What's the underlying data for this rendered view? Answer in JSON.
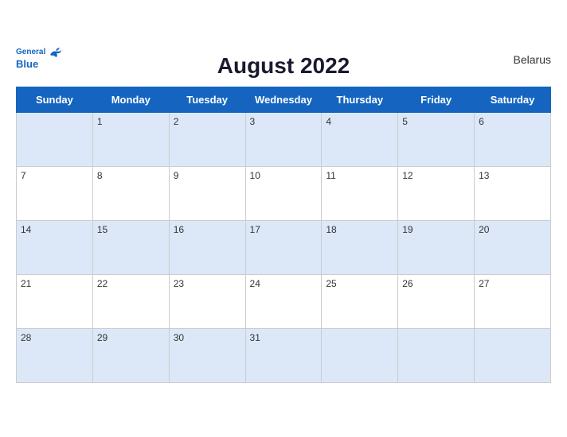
{
  "header": {
    "title": "August 2022",
    "country": "Belarus",
    "logo_general": "General",
    "logo_blue": "Blue"
  },
  "weekdays": [
    "Sunday",
    "Monday",
    "Tuesday",
    "Wednesday",
    "Thursday",
    "Friday",
    "Saturday"
  ],
  "weeks": [
    [
      "",
      "1",
      "2",
      "3",
      "4",
      "5",
      "6"
    ],
    [
      "7",
      "8",
      "9",
      "10",
      "11",
      "12",
      "13"
    ],
    [
      "14",
      "15",
      "16",
      "17",
      "18",
      "19",
      "20"
    ],
    [
      "21",
      "22",
      "23",
      "24",
      "25",
      "26",
      "27"
    ],
    [
      "28",
      "29",
      "30",
      "31",
      "",
      "",
      ""
    ]
  ]
}
